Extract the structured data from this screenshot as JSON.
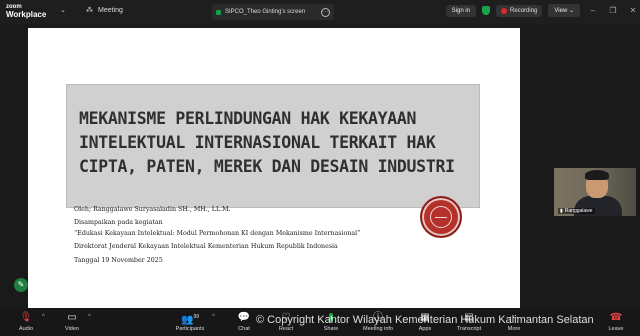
{
  "app": {
    "logo_line1": "zoom",
    "logo_line2": "Workplace",
    "meeting_label": "Meeting",
    "share_tab_label": "SIPCO_Theo Ginting's screen",
    "sign_in": "Sign in",
    "recording": "Recording",
    "view": "View"
  },
  "slide": {
    "title": "Mekanisme Perlindungan Hak Kekayaan Intelektual Internasional Terkait Hak Cipta, Paten, Merek dan Desain Industri",
    "body": [
      "Oleh; Ranggalawe Suryasaladin SH., MH., LL.M.",
      "Disampaikan pada kegiatan",
      "“Edukasi Kekayaan Intelektual: Modul Permohonan KI dengan Mekanisme Internasional”",
      "Direktorat Jenderal Kekayaan Intelektual Kementerian Hukum Republik Indonesia",
      "Tanggal 19 November 2025"
    ]
  },
  "participant_video": {
    "name": "Ranggalawe"
  },
  "toolbar": {
    "audio": "Audio",
    "video": "Video",
    "participants": "Participants",
    "participants_count": "99",
    "chat": "Chat",
    "react": "React",
    "share": "Share",
    "meeting_info": "Meeting info",
    "apps": "Apps",
    "transcript": "Transcript",
    "more": "More",
    "leave": "Leave"
  },
  "watermark": "© Copyright Kantor Wilayah Kementerian Hukum Kalimantan Selatan",
  "colors": {
    "share_green": "#18a24a",
    "record_red": "#e02828",
    "shield_green": "#1aa34a",
    "leave_red": "#e14242"
  }
}
